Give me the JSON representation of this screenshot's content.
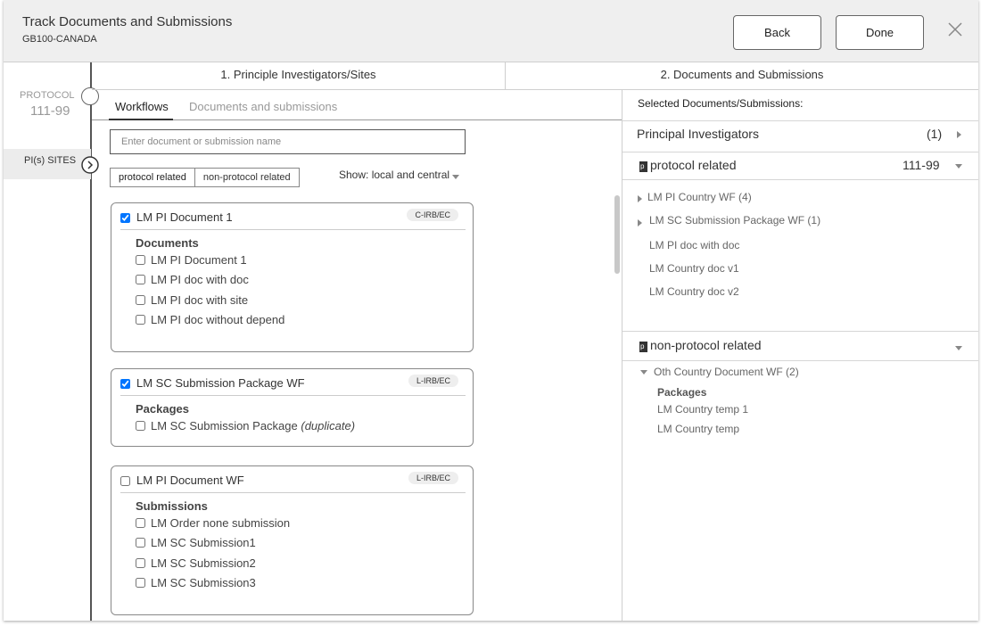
{
  "header": {
    "title": "Track Documents and Submissions",
    "subtitle": "GB100-CANADA",
    "back_label": "Back",
    "done_label": "Done"
  },
  "rail": {
    "protocol_label": "PROTOCOL",
    "protocol_value": "111-99",
    "pi_sites_label": "PI(s) SITES"
  },
  "steps": [
    {
      "label": "1. Principle Investigators/Sites"
    },
    {
      "label": "2. Documents and Submissions"
    }
  ],
  "middle": {
    "tabs": [
      {
        "label": "Workflows",
        "active": true
      },
      {
        "label": "Documents and submissions",
        "active": false
      }
    ],
    "search_placeholder": "Enter document or submission name",
    "toggle": {
      "on": "protocol related",
      "off": "non-protocol related"
    },
    "show_label": "Show:",
    "show_value": "local and central",
    "cards": [
      {
        "title": "LM PI Document 1",
        "checked": true,
        "badge": "C-IRB/EC",
        "section": "Documents",
        "items": [
          "LM PI Document 1",
          "LM PI doc with doc",
          "LM PI doc with site",
          "LM PI doc without depend"
        ]
      },
      {
        "title": "LM SC Submission Package WF",
        "checked": true,
        "badge": "L-IRB/EC",
        "section": "Packages",
        "items": [
          "LM SC Submission Package"
        ],
        "item_suffix": "(duplicate)"
      },
      {
        "title": "LM PI Document WF",
        "checked": false,
        "badge": "L-IRB/EC",
        "section": "Submissions",
        "items": [
          "LM Order none submission",
          "LM SC Submission1",
          "LM SC Submission2",
          "LM SC Submission3"
        ]
      }
    ]
  },
  "right": {
    "header": "Selected Documents/Submissions:",
    "principal_investigators": {
      "label": "Principal Investigators",
      "count": "(1)"
    },
    "protocol_related": {
      "label": "protocol related",
      "value": "111-99",
      "groups": [
        "LM PI Country WF (4)",
        "LM SC Submission Package WF (1)"
      ],
      "items": [
        "LM PI doc with doc",
        "LM Country doc v1",
        "LM Country doc v2"
      ]
    },
    "non_protocol_related": {
      "label": "non-protocol related",
      "group": "Oth Country Document WF (2)",
      "section": "Packages",
      "items": [
        "LM Country temp 1",
        "LM Country temp"
      ]
    }
  }
}
